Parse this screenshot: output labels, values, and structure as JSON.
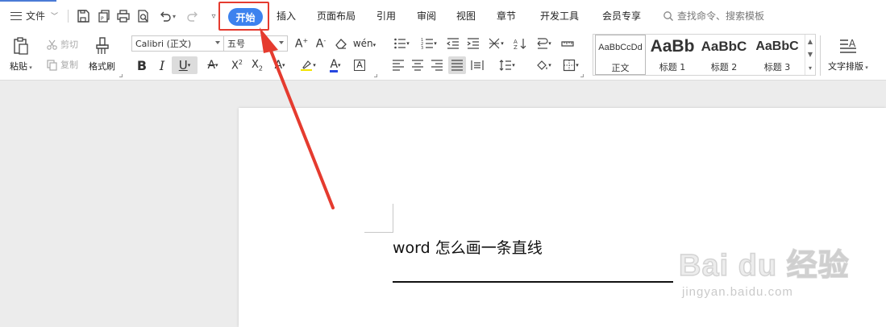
{
  "menu": {
    "file_label": "文件",
    "tabs": {
      "home": "开始",
      "insert": "插入",
      "page_layout": "页面布局",
      "reference": "引用",
      "review": "审阅",
      "view": "视图",
      "chapter": "章节",
      "developer": "开发工具",
      "member": "会员专享"
    },
    "search_placeholder": "查找命令、搜索模板"
  },
  "ribbon": {
    "paste_label": "粘贴",
    "cut_label": "剪切",
    "copy_label": "复制",
    "format_painter_label": "格式刷",
    "font_name": "Calibri (正文)",
    "font_size": "五号",
    "styles": [
      {
        "sample": "AaBbCcDd",
        "name": "正文"
      },
      {
        "sample": "AaBb",
        "name": "标题 1"
      },
      {
        "sample": "AaBbC",
        "name": "标题 2"
      },
      {
        "sample": "AaBbC",
        "name": "标题 3"
      }
    ],
    "text_layout_label": "文字排版"
  },
  "document": {
    "text": "word 怎么画一条直线"
  },
  "watermark": {
    "main": "Bai du 经验",
    "sub": "jingyan.baidu.com"
  },
  "colors": {
    "active_tab": "#3d82ee",
    "highlight_box": "#e53b2f",
    "arrow": "#e53b2f",
    "font_color_bar": "#2747e0"
  }
}
